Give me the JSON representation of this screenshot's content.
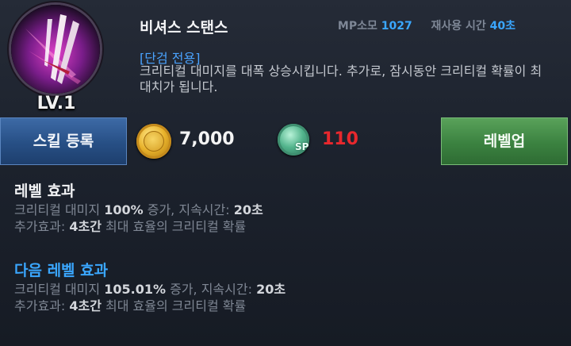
{
  "skill": {
    "level": "LV.1",
    "name": "비셔스 스탠스",
    "mp_label": "MP소모",
    "mp_value": "1027",
    "cooldown_label": "재사용 시간",
    "cooldown_value": "40초",
    "weapon_tag": "[단검 전용]",
    "description": "크리티컬 대미지를 대폭 상승시킵니다. 추가로, 잠시동안 크리티컬 확률이 최대치가 됩니다."
  },
  "actions": {
    "register_label": "스킬 등록",
    "gold_cost": "7,000",
    "sp_icon_label": "SP",
    "sp_cost": "110",
    "level_up_label": "레벨업"
  },
  "current_effect": {
    "title": "레벨 효과",
    "line1_a": "크리티컬 대미지 ",
    "line1_b": "100%",
    "line1_c": " 증가, 지속시간: ",
    "line1_d": "20초",
    "line2_a": "추가효과: ",
    "line2_b": "4초간",
    "line2_c": " 최대 효율의 크리티컬 확률"
  },
  "next_effect": {
    "title": "다음 레벨 효과",
    "line1_a": "크리티컬 대미지 ",
    "line1_b": "105.01%",
    "line1_c": " 증가, 지속시간: ",
    "line1_d": "20초",
    "line2_a": "추가효과: ",
    "line2_b": "4초간",
    "line2_c": " 최대 효율의 크리티컬 확률"
  },
  "colors": {
    "accent_blue": "#3aa7ff",
    "sp_red": "#e8282d",
    "register_blue": "#274f85",
    "levelup_green": "#3b8240"
  }
}
